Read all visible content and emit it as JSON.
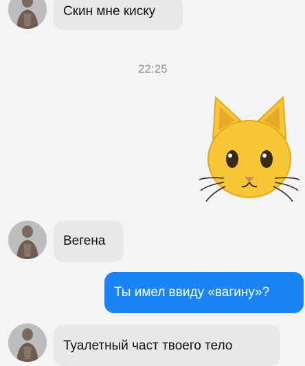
{
  "chat": {
    "messages": [
      {
        "direction": "incoming",
        "text": "Скин мне киску"
      },
      {
        "type": "timestamp",
        "text": "22:25"
      },
      {
        "direction": "outgoing",
        "type": "sticker",
        "sticker": "cat-face-emoji"
      },
      {
        "direction": "incoming",
        "text": "Вегена"
      },
      {
        "direction": "outgoing",
        "text": "Ты имел ввиду «вагину»?"
      },
      {
        "direction": "incoming",
        "text": "Туалетный част твоего тело"
      }
    ]
  },
  "colors": {
    "background": "#f4f4f6",
    "incoming_bubble": "#e8e8ea",
    "outgoing_bubble": "#1a84f5",
    "timestamp": "#8e8e93",
    "cat_yellow": "#f6c637"
  }
}
